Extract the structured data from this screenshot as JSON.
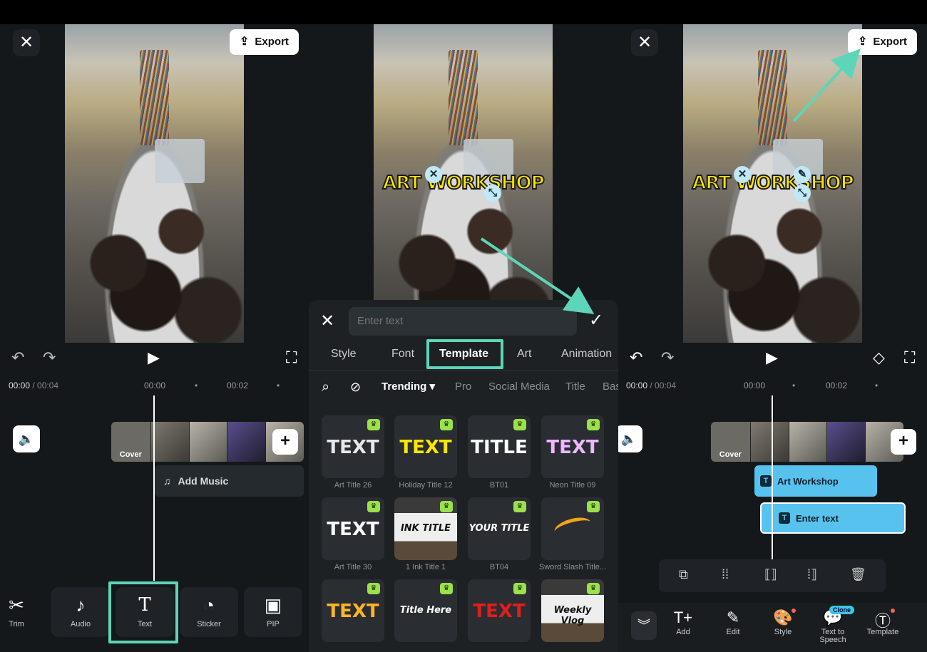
{
  "panel1": {
    "export_label": "Export",
    "time_current": "00:00",
    "time_total": " / 00:04",
    "ticks": [
      "00:00",
      "00:02"
    ],
    "cover_label": "Cover",
    "add_music_label": "Add Music",
    "tools": [
      {
        "label": "Trim",
        "icon": "scissors-icon"
      },
      {
        "label": "Audio",
        "icon": "music-note-icon"
      },
      {
        "label": "Text",
        "icon": "text-icon"
      },
      {
        "label": "Sticker",
        "icon": "sticker-icon"
      },
      {
        "label": "PIP",
        "icon": "pip-icon"
      }
    ]
  },
  "panel2": {
    "overlay_text": "ART WORKSHOP",
    "input_placeholder": "Enter text",
    "tabs": [
      "Style",
      "Font",
      "Template",
      "Art",
      "Animation"
    ],
    "active_tab": "Template",
    "subtabs": [
      "Trending",
      "Pro",
      "Social Media",
      "Title",
      "Bas"
    ],
    "active_subtab": "Trending",
    "templates": [
      {
        "preview": "TEXT",
        "caption": "Art Title 26",
        "color": "#e8e8e8"
      },
      {
        "preview": "TEXT",
        "caption": "Holiday Title 12",
        "color": "#ffe600"
      },
      {
        "preview": "TITLE",
        "caption": "BT01",
        "color": "#ffffff"
      },
      {
        "preview": "TEXT",
        "caption": "Neon Title 09",
        "color": "#f0b7ff"
      },
      {
        "preview": "TEXT",
        "caption": "Art Title 30",
        "color": "#ffffff"
      },
      {
        "preview": "INK TITLE",
        "caption": "1 Ink Title 1",
        "color": "#111111"
      },
      {
        "preview": "YOUR TITLE",
        "caption": "BT04",
        "color": "#ffffff"
      },
      {
        "preview": "",
        "caption": "Sword Slash Title...",
        "color": "#f3a21b"
      },
      {
        "preview": "TEXT",
        "caption": "",
        "color": "#ffb520"
      },
      {
        "preview": "Title Here",
        "caption": "",
        "color": "#ffffff"
      },
      {
        "preview": "TEXT",
        "caption": "",
        "color": "#e01e1e"
      },
      {
        "preview": "Weekly Vlog",
        "caption": "",
        "color": "#111111"
      }
    ]
  },
  "panel3": {
    "overlay_text": "ART WORKSHOP",
    "export_label": "Export",
    "time_current": "00:00",
    "time_total": " / 00:04",
    "ticks": [
      "00:00",
      "00:02"
    ],
    "cover_label": "Cover",
    "track1_label": "Art Workshop",
    "track2_label": "Enter text",
    "bottom": [
      {
        "label": "Add",
        "icon": "add-text-icon"
      },
      {
        "label": "Edit",
        "icon": "pencil-icon"
      },
      {
        "label": "Style",
        "icon": "palette-icon"
      },
      {
        "label": "Text to Speech",
        "icon": "speech-icon"
      },
      {
        "label": "Template",
        "icon": "template-icon"
      }
    ],
    "clone_badge": "Clone"
  },
  "accent": "#5ed5b8"
}
